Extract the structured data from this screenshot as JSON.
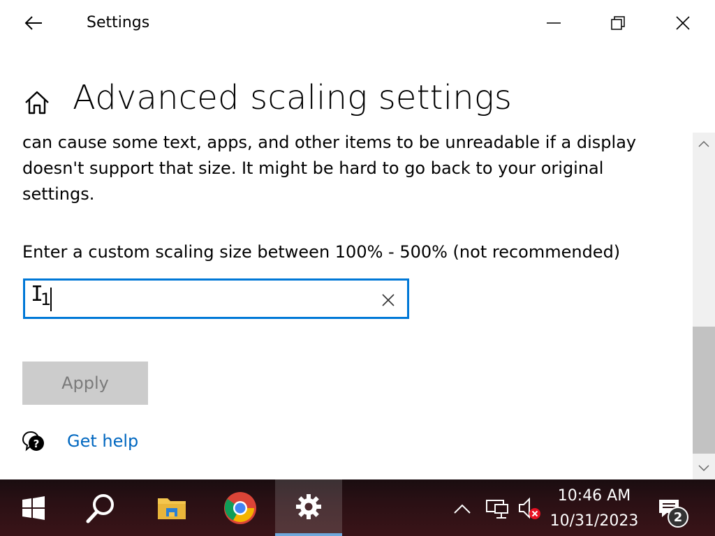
{
  "window": {
    "title": "Settings"
  },
  "page": {
    "title": "Advanced scaling settings",
    "description": "can cause some text, apps, and other items to be unreadable if a display doesn't support that size. It might be hard to go back to your original settings."
  },
  "custom_scaling": {
    "label": "Enter a custom scaling size between 100% - 500% (not recommended)",
    "value": "1",
    "apply_label": "Apply"
  },
  "help": {
    "link_label": "Get help"
  },
  "taskbar": {
    "clock_time": "10:46 AM",
    "clock_date": "10/31/2023",
    "notification_count": "2",
    "pinned": [
      "start-icon",
      "search-icon",
      "file-explorer-icon",
      "chrome-icon",
      "settings-icon"
    ]
  },
  "colors": {
    "accent": "#0078d7",
    "link": "#0067c0",
    "button_disabled_bg": "#cccccc",
    "taskbar_bg": "#2a1014"
  }
}
